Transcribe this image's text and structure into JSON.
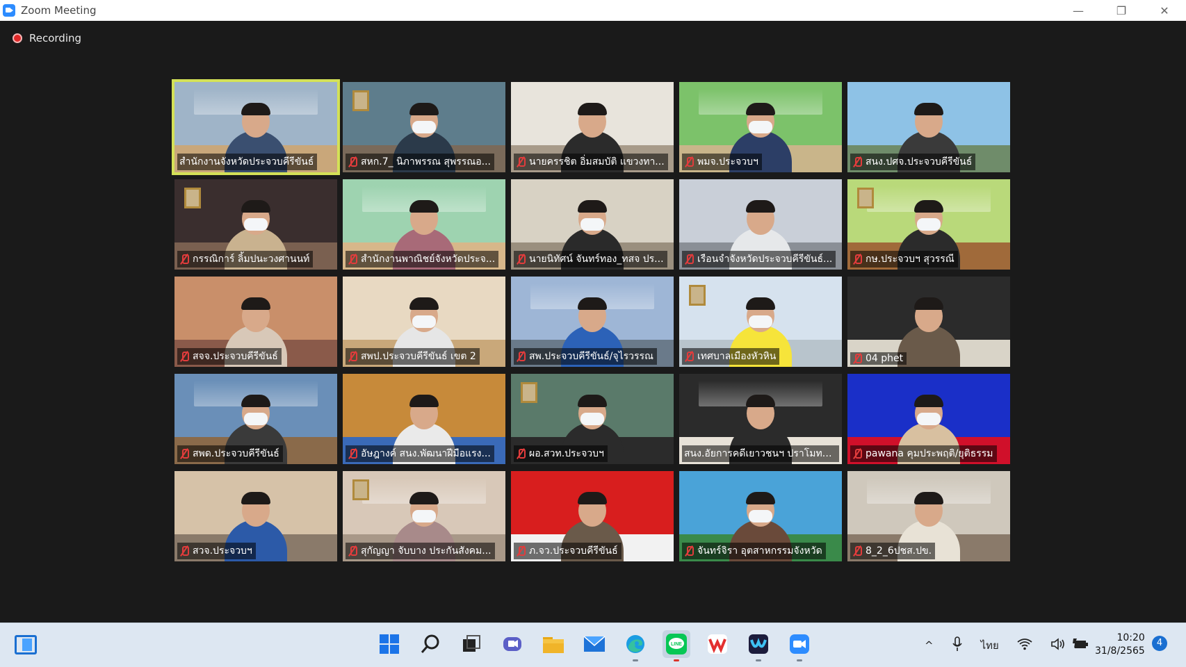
{
  "window": {
    "title": "Zoom Meeting",
    "minimize": "—",
    "restore": "❐",
    "close": "✕"
  },
  "recording": {
    "label": "Recording"
  },
  "participants": [
    {
      "name": "สำนักงานจังหวัดประจวบคีรีขันธ์",
      "muted": false,
      "active": true
    },
    {
      "name": "สหก.7_ นิภาพรรณ สุพรรณอ...",
      "muted": true
    },
    {
      "name": "นายครรชิต อิ่มสมบัติ แขวงทา...",
      "muted": true
    },
    {
      "name": "พมจ.ประจวบฯ",
      "muted": true
    },
    {
      "name": "สนง.ปศจ.ประจวบคีรีขันธ์",
      "muted": true
    },
    {
      "name": "กรรณิการ์ ลิ้มปนะวงศานนท์",
      "muted": true
    },
    {
      "name": "สำนักงานพาณิชย์จังหวัดประจ...",
      "muted": true
    },
    {
      "name": "นายนิทัศน์ จันทร์ทอง_ทสจ ปร...",
      "muted": true
    },
    {
      "name": "เรือนจำจังหวัดประจวบคีรีขันธ์...",
      "muted": true
    },
    {
      "name": "กษ.ประจวบฯ สุวรรณี",
      "muted": true
    },
    {
      "name": "สจจ.ประจวบคีรีขันธ์",
      "muted": true
    },
    {
      "name": "สพป.ประจวบคีรีขันธ์ เขต 2",
      "muted": true
    },
    {
      "name": "สพ.ประจวบคีรีขันธ์/จุไรวรรณ",
      "muted": true
    },
    {
      "name": "เทศบาลเมืองหัวหิน",
      "muted": true
    },
    {
      "name": "04 phet",
      "muted": true
    },
    {
      "name": "สพด.ประจวบคีรีขันธ์",
      "muted": true
    },
    {
      "name": "อัษฎางค์ สนง.พัฒนาฝีมือแรง...",
      "muted": true
    },
    {
      "name": "ผอ.สวท.ประจวบฯ",
      "muted": true
    },
    {
      "name": "สนง.อัยการคดีเยาวชนฯ ปราโมทย์...",
      "muted": false
    },
    {
      "name": "pawana คุมประพฤติ/ยุติธรรม",
      "muted": true
    },
    {
      "name": "สวจ.ประจวบฯ",
      "muted": true
    },
    {
      "name": "สุกัญญา จับบาง ประกันสังคม...",
      "muted": true
    },
    {
      "name": "ภ.จว.ประจวบคีรีขันธ์",
      "muted": true
    },
    {
      "name": "จันทร์จิรา อุตสาหกรรมจังหวัด",
      "muted": true
    },
    {
      "name": "8_2_6ปชส.ปข.",
      "muted": true
    }
  ],
  "taskbar": {
    "tray": {
      "chevron": "^",
      "language": "ไทย"
    },
    "clock": {
      "time": "10:20",
      "date": "31/8/2565"
    },
    "notifications": "4"
  }
}
